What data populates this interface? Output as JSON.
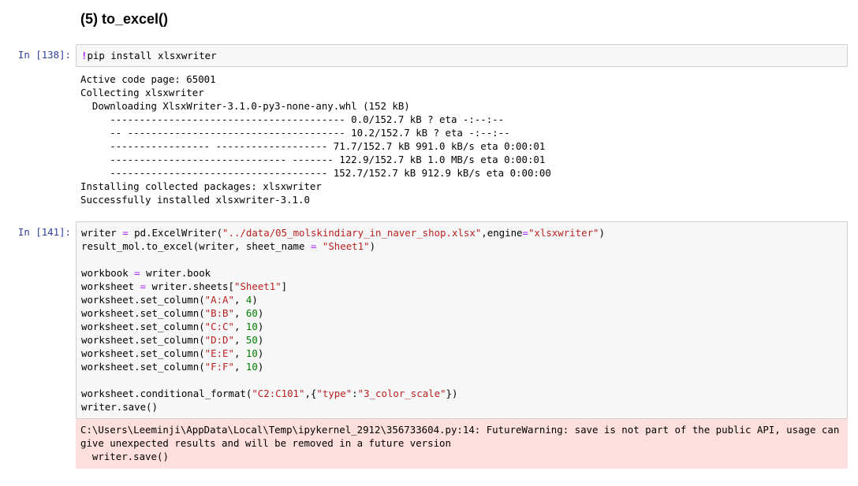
{
  "heading": "(5) to_excel()",
  "cell1": {
    "prompt": "In [138]:",
    "code_bang": "!",
    "code_rest": "pip install xlsxwriter",
    "output_lines": [
      "Active code page: 65001",
      "Collecting xlsxwriter",
      "  Downloading XlsxWriter-3.1.0-py3-none-any.whl (152 kB)",
      "     ---------------------------------------- 0.0/152.7 kB ? eta -:--:--",
      "     -- ------------------------------------- 10.2/152.7 kB ? eta -:--:--",
      "     ----------------- ------------------- 71.7/152.7 kB 991.0 kB/s eta 0:00:01",
      "     ------------------------------ ------- 122.9/152.7 kB 1.0 MB/s eta 0:00:01",
      "     ------------------------------------- 152.7/152.7 kB 912.9 kB/s eta 0:00:00",
      "Installing collected packages: xlsxwriter",
      "Successfully installed xlsxwriter-3.1.0"
    ]
  },
  "cell2": {
    "prompt": "In [141]:",
    "lines": [
      [
        {
          "t": "writer "
        },
        {
          "t": "=",
          "c": "o"
        },
        {
          "t": " pd.ExcelWriter("
        },
        {
          "t": "\"../data/05_molskindiary_in_naver_shop.xlsx\"",
          "c": "s"
        },
        {
          "t": ",engine"
        },
        {
          "t": "=",
          "c": "o"
        },
        {
          "t": "\"xlsxwriter\"",
          "c": "s"
        },
        {
          "t": ")"
        }
      ],
      [
        {
          "t": "result_mol.to_excel(writer, sheet_name "
        },
        {
          "t": "=",
          "c": "o"
        },
        {
          "t": " "
        },
        {
          "t": "\"Sheet1\"",
          "c": "s"
        },
        {
          "t": ")"
        }
      ],
      [],
      [
        {
          "t": "workbook "
        },
        {
          "t": "=",
          "c": "o"
        },
        {
          "t": " writer.book"
        }
      ],
      [
        {
          "t": "worksheet "
        },
        {
          "t": "=",
          "c": "o"
        },
        {
          "t": " writer.sheets["
        },
        {
          "t": "\"Sheet1\"",
          "c": "s"
        },
        {
          "t": "]"
        }
      ],
      [
        {
          "t": "worksheet.set_column("
        },
        {
          "t": "\"A:A\"",
          "c": "s"
        },
        {
          "t": ", "
        },
        {
          "t": "4",
          "c": "n"
        },
        {
          "t": ")"
        }
      ],
      [
        {
          "t": "worksheet.set_column("
        },
        {
          "t": "\"B:B\"",
          "c": "s"
        },
        {
          "t": ", "
        },
        {
          "t": "60",
          "c": "n"
        },
        {
          "t": ")"
        }
      ],
      [
        {
          "t": "worksheet.set_column("
        },
        {
          "t": "\"C:C\"",
          "c": "s"
        },
        {
          "t": ", "
        },
        {
          "t": "10",
          "c": "n"
        },
        {
          "t": ")"
        }
      ],
      [
        {
          "t": "worksheet.set_column("
        },
        {
          "t": "\"D:D\"",
          "c": "s"
        },
        {
          "t": ", "
        },
        {
          "t": "50",
          "c": "n"
        },
        {
          "t": ")"
        }
      ],
      [
        {
          "t": "worksheet.set_column("
        },
        {
          "t": "\"E:E\"",
          "c": "s"
        },
        {
          "t": ", "
        },
        {
          "t": "10",
          "c": "n"
        },
        {
          "t": ")"
        }
      ],
      [
        {
          "t": "worksheet.set_column("
        },
        {
          "t": "\"F:F\"",
          "c": "s"
        },
        {
          "t": ", "
        },
        {
          "t": "10",
          "c": "n"
        },
        {
          "t": ")"
        }
      ],
      [],
      [
        {
          "t": "worksheet.conditional_format("
        },
        {
          "t": "\"C2:C101\"",
          "c": "s"
        },
        {
          "t": ",{"
        },
        {
          "t": "\"type\"",
          "c": "s"
        },
        {
          "t": ":"
        },
        {
          "t": "\"3_color_scale\"",
          "c": "s"
        },
        {
          "t": "})"
        }
      ],
      [
        {
          "t": "writer.save()"
        }
      ]
    ],
    "stderr": "C:\\Users\\Leeminji\\AppData\\Local\\Temp\\ipykernel_2912\\356733604.py:14: FutureWarning: save is not part of the public API, usage can give unexpected results and will be removed in a future version\n  writer.save()"
  }
}
